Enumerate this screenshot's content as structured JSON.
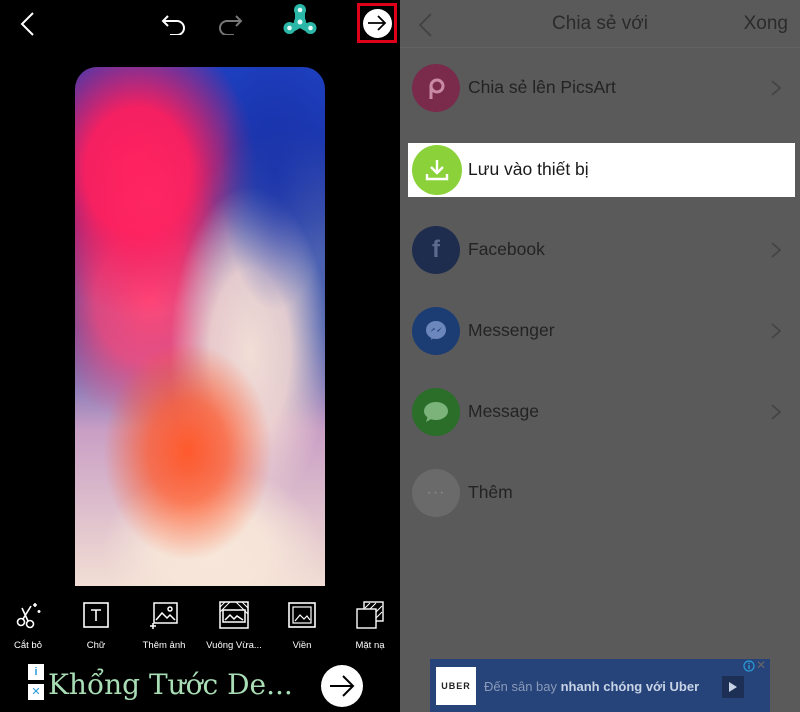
{
  "left": {
    "toolbar": {
      "back": "back",
      "undo": "undo",
      "redo": "redo",
      "spinner": "fidget-spinner",
      "next": "next"
    },
    "tools": [
      {
        "label": "Cắt bỏ",
        "icon": "cutout-icon"
      },
      {
        "label": "Chữ",
        "icon": "text-icon"
      },
      {
        "label": "Thêm ảnh",
        "icon": "add-photo-icon"
      },
      {
        "label": "Vuông Vừa...",
        "icon": "square-fit-icon"
      },
      {
        "label": "Viền",
        "icon": "border-icon"
      },
      {
        "label": "Mặt nạ",
        "icon": "mask-icon"
      }
    ],
    "ad": {
      "title": "Khổng Tước De...",
      "info_icon": "i",
      "close_icon": "✕"
    }
  },
  "right": {
    "nav": {
      "title": "Chia sẻ với",
      "done": "Xong"
    },
    "rows": [
      {
        "label": "Chia sẻ lên PicsArt",
        "icon": "picsart-icon",
        "color": "#7a2a4a"
      },
      {
        "label": "Lưu vào thiết bị",
        "icon": "download-icon",
        "color": "#8bd23a"
      },
      {
        "label": "Facebook",
        "icon": "facebook-icon",
        "color": "#1e2c4e"
      },
      {
        "label": "Messenger",
        "icon": "messenger-icon",
        "color": "#1c3d74"
      },
      {
        "label": "Message",
        "icon": "message-icon",
        "color": "#2a6e2a"
      },
      {
        "label": "Thêm",
        "icon": "more-icon",
        "color": "#6a6a6a"
      }
    ],
    "ad": {
      "logo": "UBER",
      "text_pre": "Đến sân bay ",
      "text_bold": "nhanh chóng với Uber"
    }
  },
  "colors": {
    "highlight_border": "#e0001a",
    "spinner": "#2bb7a8",
    "save_green": "#8bd23a",
    "overlay_gray": "#5a5a5a"
  }
}
